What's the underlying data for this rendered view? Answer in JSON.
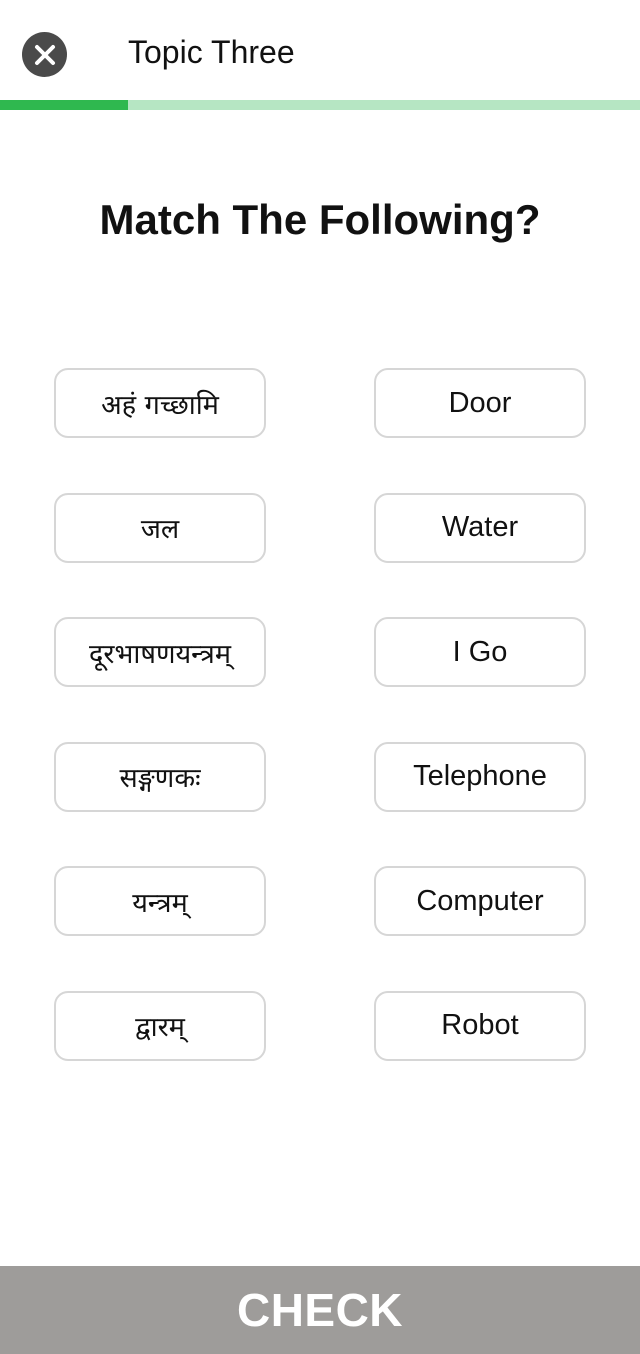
{
  "header": {
    "title": "Topic Three",
    "close_icon": "close-icon",
    "progress_fraction": 0.2
  },
  "question": "Match The Following?",
  "left_options": [
    "अहं गच्छामि",
    "जल",
    "दूरभाषणयन्त्रम्",
    "सङ्गणकः",
    "यन्त्रम्",
    "द्वारम्"
  ],
  "right_options": [
    "Door",
    "Water",
    "I Go",
    "Telephone",
    "Computer",
    "Robot"
  ],
  "check_label": "CHECK",
  "colors": {
    "progress_fill": "#2fb84f",
    "progress_track": "#b6e6c3",
    "check_bar": "#9e9c9a",
    "close_button": "#4a4a4a"
  }
}
